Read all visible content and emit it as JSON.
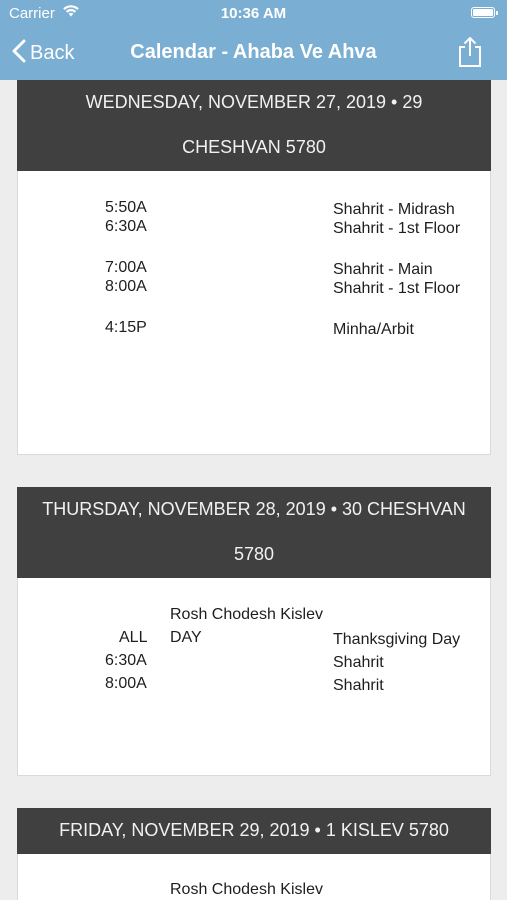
{
  "status_bar": {
    "carrier": "Carrier",
    "time": "10:36 AM"
  },
  "nav": {
    "back_label": "Back",
    "title": "Calendar - Ahaba Ve Ahva"
  },
  "days": [
    {
      "header_line1": "WEDNESDAY, NOVEMBER 27, 2019  •  29",
      "header_line2": "CHESHVAN 5780",
      "events": [
        {
          "time": "5:50A",
          "name": "Shahrit - Midrash"
        },
        {
          "time": "6:30A",
          "name": "Shahrit - 1st Floor"
        },
        {
          "time": "7:00A",
          "name": "Shahrit - Main"
        },
        {
          "time": "8:00A",
          "name": "Shahrit - 1st Floor"
        },
        {
          "time": "4:15P",
          "name": "Minha/Arbit"
        }
      ]
    },
    {
      "header_line1": "THURSDAY, NOVEMBER 28, 2019  •  30 CHESHVAN",
      "header_line2": "5780",
      "note": "Rosh Chodesh Kislev",
      "events": [
        {
          "time": "ALL",
          "day": "DAY",
          "name": "Thanksgiving Day"
        },
        {
          "time": "6:30A",
          "name": "Shahrit"
        },
        {
          "time": "8:00A",
          "name": "Shahrit"
        }
      ]
    },
    {
      "header_line1": "FRIDAY, NOVEMBER 29, 2019  •  1 KISLEV 5780",
      "note": "Rosh Chodesh Kislev"
    }
  ],
  "colors": {
    "nav_background": "#7aaed2",
    "day_header_background": "#404040",
    "page_background": "#ededed"
  }
}
